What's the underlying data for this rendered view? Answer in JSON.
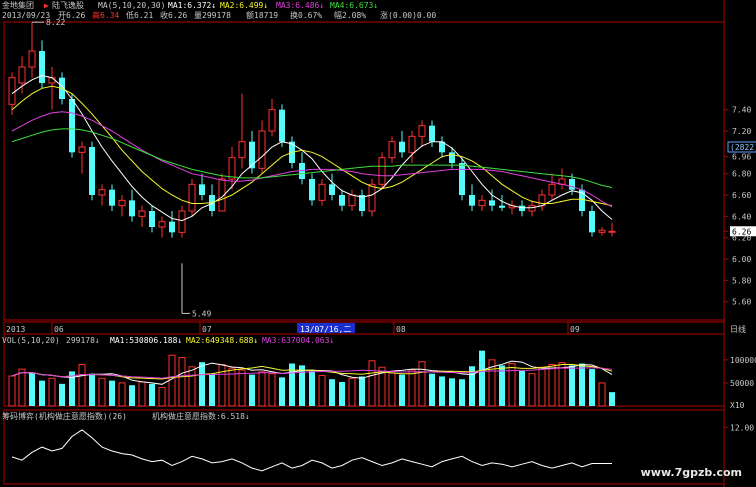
{
  "header": {
    "app_name": "金地集团",
    "indicator_name": "陆飞逸股",
    "ma_params": "MA(5,10,20,30)",
    "ma1": "MA1:6.372↓",
    "ma2": "MA2:6.499↓",
    "ma3": "MA3:6.486↓",
    "ma4": "MA4:6.673↓",
    "date": "2013/09/23",
    "open": "开6.26",
    "high": "高6.34",
    "low": "低6.21",
    "close": "收6.26",
    "volume": "量299178",
    "amount": "额18719",
    "turnover": "换0.67%",
    "amplitude": "幅2.08%",
    "change": "涨(0.00)0.00"
  },
  "colors": {
    "background": "#000000",
    "up": "#ff3030",
    "down": "#54fcfc",
    "ma1": "#ffffff",
    "ma2": "#f7f72a",
    "ma3": "#e040e0",
    "ma4": "#40e040",
    "axis": "#b00000",
    "label": "#c8c8c8"
  },
  "price_panel": {
    "y_ticks": [
      "7.40",
      "7.20",
      "6.96",
      "6.80",
      "6.60",
      "6.40",
      "6.26",
      "6.20",
      "6.00",
      "5.80",
      "5.60"
    ],
    "price_count_box": "(2822)",
    "high_marker": "8.22",
    "low_marker": "5.49"
  },
  "date_axis": {
    "labels": [
      "2013",
      "06",
      "07",
      "08",
      "09"
    ],
    "cursor_date": "13/07/16,二",
    "period": "日线"
  },
  "volume_panel": {
    "label": "VOL(5,10,20)",
    "value": "299178↓",
    "ma1": "MA1:530806.188↓",
    "ma2": "MA2:649348.688↓",
    "ma3": "MA3:637004.063↓",
    "y_ticks": [
      "100000",
      "50000"
    ],
    "unit": "X10"
  },
  "indicator_panel": {
    "label": "筹码博弈(机构做庄意愿指数)(26)",
    "value_label": "机构做庄意愿指数:6.518↓",
    "y_tick": "12.00"
  },
  "watermark": "www.7gpzb.com",
  "chart_data": {
    "type": "candlestick",
    "ylim": [
      5.49,
      8.22
    ],
    "date_labels": [
      "2013",
      "06",
      "07",
      "08",
      "09"
    ],
    "candles": [
      {
        "o": 7.45,
        "h": 7.75,
        "l": 7.35,
        "c": 7.7
      },
      {
        "o": 7.65,
        "h": 7.9,
        "l": 7.55,
        "c": 7.8
      },
      {
        "o": 7.8,
        "h": 8.22,
        "l": 7.7,
        "c": 7.95
      },
      {
        "o": 7.95,
        "h": 8.05,
        "l": 7.6,
        "c": 7.65
      },
      {
        "o": 7.65,
        "h": 7.8,
        "l": 7.4,
        "c": 7.7
      },
      {
        "o": 7.7,
        "h": 7.75,
        "l": 7.45,
        "c": 7.5
      },
      {
        "o": 7.5,
        "h": 7.55,
        "l": 6.95,
        "c": 7.0
      },
      {
        "o": 7.0,
        "h": 7.1,
        "l": 6.8,
        "c": 7.05
      },
      {
        "o": 7.05,
        "h": 7.1,
        "l": 6.55,
        "c": 6.6
      },
      {
        "o": 6.6,
        "h": 6.7,
        "l": 6.5,
        "c": 6.65
      },
      {
        "o": 6.65,
        "h": 6.7,
        "l": 6.45,
        "c": 6.5
      },
      {
        "o": 6.5,
        "h": 6.6,
        "l": 6.4,
        "c": 6.55
      },
      {
        "o": 6.55,
        "h": 6.65,
        "l": 6.35,
        "c": 6.4
      },
      {
        "o": 6.4,
        "h": 6.5,
        "l": 6.3,
        "c": 6.45
      },
      {
        "o": 6.45,
        "h": 6.5,
        "l": 6.25,
        "c": 6.3
      },
      {
        "o": 6.3,
        "h": 6.4,
        "l": 6.2,
        "c": 6.35
      },
      {
        "o": 6.35,
        "h": 6.45,
        "l": 6.2,
        "c": 6.25
      },
      {
        "o": 6.25,
        "h": 6.5,
        "l": 6.2,
        "c": 6.45
      },
      {
        "o": 6.45,
        "h": 6.75,
        "l": 6.4,
        "c": 6.7
      },
      {
        "o": 6.7,
        "h": 6.8,
        "l": 6.55,
        "c": 6.6
      },
      {
        "o": 6.6,
        "h": 6.7,
        "l": 6.4,
        "c": 6.45
      },
      {
        "o": 6.45,
        "h": 6.8,
        "l": 6.45,
        "c": 6.75
      },
      {
        "o": 6.75,
        "h": 7.05,
        "l": 6.65,
        "c": 6.95
      },
      {
        "o": 6.95,
        "h": 7.55,
        "l": 6.85,
        "c": 7.1
      },
      {
        "o": 7.1,
        "h": 7.2,
        "l": 6.8,
        "c": 6.85
      },
      {
        "o": 6.85,
        "h": 7.3,
        "l": 6.8,
        "c": 7.2
      },
      {
        "o": 7.2,
        "h": 7.5,
        "l": 7.15,
        "c": 7.4
      },
      {
        "o": 7.4,
        "h": 7.45,
        "l": 7.05,
        "c": 7.1
      },
      {
        "o": 7.1,
        "h": 7.15,
        "l": 6.85,
        "c": 6.9
      },
      {
        "o": 6.9,
        "h": 7.0,
        "l": 6.7,
        "c": 6.75
      },
      {
        "o": 6.75,
        "h": 6.8,
        "l": 6.5,
        "c": 6.55
      },
      {
        "o": 6.55,
        "h": 6.75,
        "l": 6.5,
        "c": 6.7
      },
      {
        "o": 6.7,
        "h": 6.8,
        "l": 6.55,
        "c": 6.6
      },
      {
        "o": 6.6,
        "h": 6.65,
        "l": 6.45,
        "c": 6.5
      },
      {
        "o": 6.5,
        "h": 6.65,
        "l": 6.45,
        "c": 6.6
      },
      {
        "o": 6.6,
        "h": 6.65,
        "l": 6.4,
        "c": 6.45
      },
      {
        "o": 6.45,
        "h": 6.75,
        "l": 6.4,
        "c": 6.7
      },
      {
        "o": 6.7,
        "h": 7.0,
        "l": 6.65,
        "c": 6.95
      },
      {
        "o": 6.95,
        "h": 7.15,
        "l": 6.9,
        "c": 7.1
      },
      {
        "o": 7.1,
        "h": 7.2,
        "l": 6.95,
        "c": 7.0
      },
      {
        "o": 7.0,
        "h": 7.2,
        "l": 6.9,
        "c": 7.15
      },
      {
        "o": 7.15,
        "h": 7.3,
        "l": 7.05,
        "c": 7.25
      },
      {
        "o": 7.25,
        "h": 7.3,
        "l": 7.05,
        "c": 7.1
      },
      {
        "o": 7.1,
        "h": 7.15,
        "l": 6.95,
        "c": 7.0
      },
      {
        "o": 7.0,
        "h": 7.05,
        "l": 6.85,
        "c": 6.9
      },
      {
        "o": 6.9,
        "h": 6.95,
        "l": 6.55,
        "c": 6.6
      },
      {
        "o": 6.6,
        "h": 6.7,
        "l": 6.45,
        "c": 6.5
      },
      {
        "o": 6.5,
        "h": 6.6,
        "l": 6.45,
        "c": 6.55
      },
      {
        "o": 6.55,
        "h": 6.65,
        "l": 6.45,
        "c": 6.5
      },
      {
        "o": 6.5,
        "h": 6.6,
        "l": 6.45,
        "c": 6.48
      },
      {
        "o": 6.48,
        "h": 6.55,
        "l": 6.42,
        "c": 6.5
      },
      {
        "o": 6.5,
        "h": 6.55,
        "l": 6.4,
        "c": 6.45
      },
      {
        "o": 6.45,
        "h": 6.55,
        "l": 6.4,
        "c": 6.5
      },
      {
        "o": 6.5,
        "h": 6.65,
        "l": 6.45,
        "c": 6.6
      },
      {
        "o": 6.6,
        "h": 6.8,
        "l": 6.55,
        "c": 6.7
      },
      {
        "o": 6.7,
        "h": 6.85,
        "l": 6.65,
        "c": 6.75
      },
      {
        "o": 6.75,
        "h": 6.8,
        "l": 6.6,
        "c": 6.65
      },
      {
        "o": 6.65,
        "h": 6.7,
        "l": 6.4,
        "c": 6.45
      },
      {
        "o": 6.45,
        "h": 6.5,
        "l": 6.21,
        "c": 6.25
      },
      {
        "o": 6.25,
        "h": 6.3,
        "l": 6.22,
        "c": 6.27
      },
      {
        "o": 6.26,
        "h": 6.34,
        "l": 6.21,
        "c": 6.26
      }
    ],
    "ma_series": [
      {
        "name": "MA1",
        "values": [
          7.55,
          7.62,
          7.68,
          7.72,
          7.7,
          7.62,
          7.5,
          7.36,
          7.2,
          7.05,
          6.92,
          6.8,
          6.68,
          6.58,
          6.5,
          6.44,
          6.38,
          6.36,
          6.4,
          6.48,
          6.52,
          6.58,
          6.68,
          6.8,
          6.88,
          6.96,
          7.05,
          7.1,
          7.08,
          7.02,
          6.94,
          6.82,
          6.72,
          6.64,
          6.6,
          6.58,
          6.6,
          6.66,
          6.76,
          6.88,
          6.98,
          7.06,
          7.1,
          7.1,
          7.04,
          6.94,
          6.82,
          6.7,
          6.6,
          6.54,
          6.5,
          6.48,
          6.48,
          6.5,
          6.55,
          6.6,
          6.64,
          6.62,
          6.55,
          6.45,
          6.37
        ]
      },
      {
        "name": "MA2",
        "values": [
          7.4,
          7.48,
          7.55,
          7.6,
          7.62,
          7.6,
          7.55,
          7.46,
          7.36,
          7.25,
          7.14,
          7.02,
          6.92,
          6.82,
          6.74,
          6.66,
          6.6,
          6.55,
          6.52,
          6.52,
          6.53,
          6.56,
          6.6,
          6.66,
          6.72,
          6.8,
          6.88,
          6.96,
          7.0,
          7.02,
          7.0,
          6.96,
          6.9,
          6.84,
          6.78,
          6.72,
          6.68,
          6.66,
          6.68,
          6.72,
          6.78,
          6.84,
          6.9,
          6.96,
          6.98,
          6.96,
          6.92,
          6.86,
          6.78,
          6.7,
          6.64,
          6.58,
          6.54,
          6.52,
          6.52,
          6.54,
          6.56,
          6.56,
          6.54,
          6.52,
          6.5
        ]
      },
      {
        "name": "MA3",
        "values": [
          7.2,
          7.25,
          7.3,
          7.34,
          7.37,
          7.38,
          7.37,
          7.34,
          7.3,
          7.25,
          7.2,
          7.14,
          7.08,
          7.02,
          6.97,
          6.92,
          6.88,
          6.84,
          6.8,
          6.78,
          6.76,
          6.74,
          6.73,
          6.73,
          6.74,
          6.76,
          6.78,
          6.8,
          6.82,
          6.83,
          6.84,
          6.84,
          6.84,
          6.83,
          6.82,
          6.8,
          6.79,
          6.78,
          6.78,
          6.79,
          6.8,
          6.81,
          6.82,
          6.83,
          6.84,
          6.84,
          6.84,
          6.84,
          6.83,
          6.82,
          6.8,
          6.78,
          6.76,
          6.74,
          6.72,
          6.7,
          6.68,
          6.65,
          6.6,
          6.54,
          6.49
        ]
      },
      {
        "name": "MA4",
        "values": [
          7.1,
          7.13,
          7.16,
          7.19,
          7.21,
          7.22,
          7.22,
          7.21,
          7.19,
          7.16,
          7.13,
          7.09,
          7.05,
          7.01,
          6.97,
          6.93,
          6.9,
          6.87,
          6.84,
          6.82,
          6.8,
          6.78,
          6.77,
          6.76,
          6.76,
          6.76,
          6.77,
          6.78,
          6.79,
          6.8,
          6.81,
          6.82,
          6.83,
          6.84,
          6.85,
          6.86,
          6.87,
          6.87,
          6.87,
          6.88,
          6.88,
          6.88,
          6.88,
          6.88,
          6.88,
          6.88,
          6.87,
          6.86,
          6.85,
          6.84,
          6.83,
          6.82,
          6.81,
          6.8,
          6.79,
          6.78,
          6.77,
          6.75,
          6.72,
          6.69,
          6.67
        ]
      }
    ],
    "volume": [
      65000,
      80000,
      72000,
      55000,
      60000,
      48000,
      75000,
      90000,
      70000,
      60000,
      55000,
      50000,
      45000,
      52000,
      48000,
      40000,
      110000,
      105000,
      85000,
      95000,
      70000,
      90000,
      82000,
      78000,
      68000,
      74000,
      70000,
      62000,
      92000,
      88000,
      76000,
      66000,
      58000,
      52000,
      60000,
      64000,
      98000,
      84000,
      72000,
      68000,
      78000,
      96000,
      70000,
      64000,
      60000,
      58000,
      86000,
      120000,
      100000,
      88000,
      92000,
      76000,
      70000,
      84000,
      90000,
      94000,
      88000,
      92000,
      80000,
      50000,
      30000
    ],
    "volume_up": [
      true,
      true,
      false,
      false,
      true,
      false,
      false,
      true,
      false,
      true,
      false,
      true,
      false,
      true,
      false,
      true,
      true,
      true,
      true,
      false,
      false,
      true,
      true,
      true,
      false,
      true,
      true,
      false,
      false,
      false,
      false,
      true,
      false,
      false,
      true,
      false,
      true,
      true,
      true,
      false,
      true,
      true,
      false,
      false,
      false,
      false,
      false,
      false,
      true,
      false,
      true,
      false,
      true,
      true,
      true,
      true,
      false,
      false,
      false,
      true,
      false
    ],
    "indicator": [
      7.5,
      7.0,
      8.2,
      9.0,
      8.4,
      8.8,
      10.6,
      11.6,
      10.4,
      9.0,
      8.4,
      8.0,
      7.8,
      7.2,
      6.8,
      7.0,
      6.2,
      6.8,
      7.6,
      7.2,
      6.6,
      6.8,
      7.2,
      6.6,
      5.8,
      5.4,
      6.0,
      6.6,
      5.8,
      6.2,
      7.0,
      6.6,
      5.8,
      6.2,
      7.0,
      7.4,
      6.8,
      6.2,
      6.6,
      7.2,
      6.8,
      6.4,
      6.0,
      6.8,
      7.2,
      7.6,
      6.8,
      6.2,
      6.6,
      6.4,
      6.0,
      6.4,
      6.8,
      6.2,
      5.8,
      6.2,
      6.6,
      6.0,
      6.5,
      6.5,
      6.5
    ]
  }
}
